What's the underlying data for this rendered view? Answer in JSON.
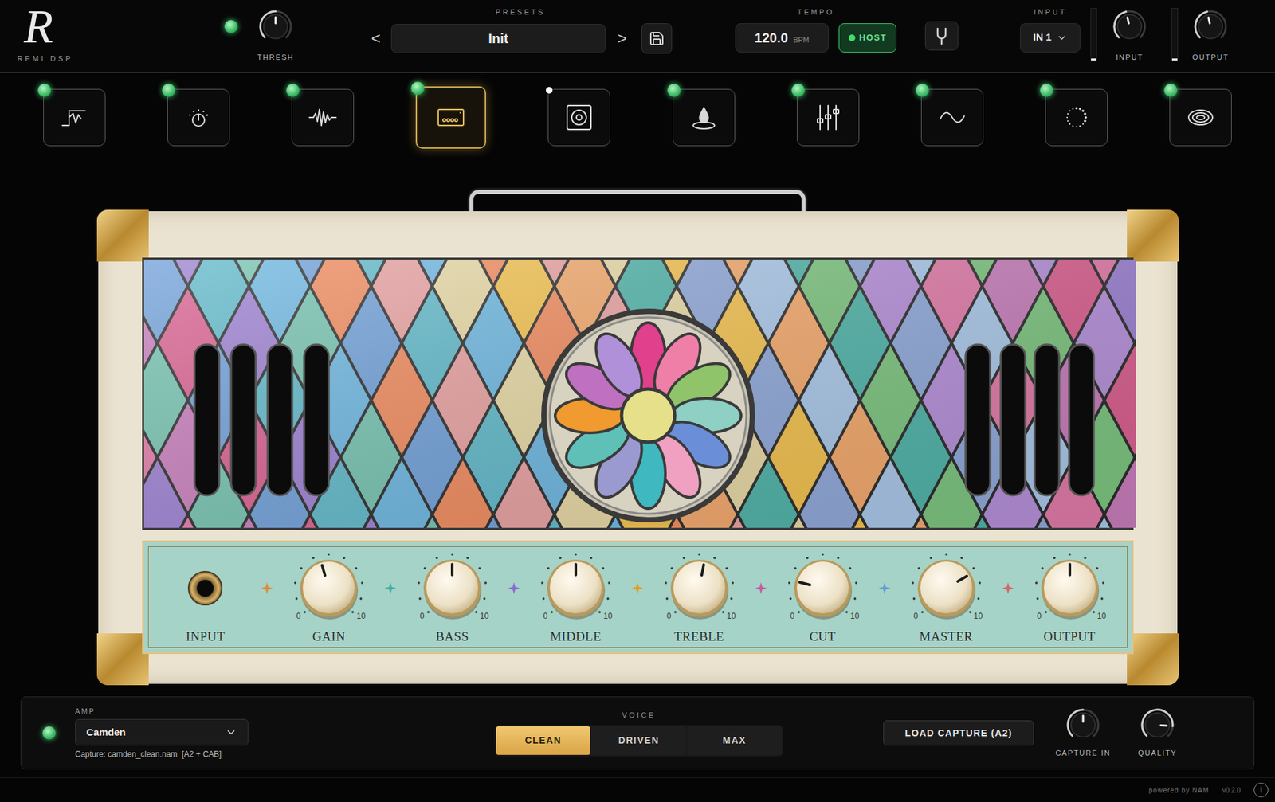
{
  "header": {
    "logo": {
      "mark": "R",
      "name": "REMI DSP"
    },
    "gate": {
      "on": true,
      "label": "THRESH",
      "level": 0.5
    },
    "presets": {
      "label": "PRESETS",
      "prev": "<",
      "name": "Init",
      "next": ">"
    },
    "tempo": {
      "label": "TEMPO",
      "value": "120.0",
      "unit": "BPM",
      "host": {
        "label": "HOST",
        "on": true
      }
    },
    "input": {
      "label": "INPUT",
      "source": "IN 1",
      "meters": [
        0.04,
        0.04
      ],
      "knobs": [
        {
          "label": "INPUT",
          "level": 0.45
        },
        {
          "label": "OUTPUT",
          "level": 0.45
        }
      ]
    }
  },
  "modules": [
    {
      "kind": "gate",
      "enabled": true,
      "selected": false
    },
    {
      "kind": "drive",
      "enabled": true,
      "selected": false
    },
    {
      "kind": "comp",
      "enabled": true,
      "selected": false
    },
    {
      "kind": "amp",
      "enabled": true,
      "selected": true
    },
    {
      "kind": "cab",
      "enabled": false,
      "selected": false
    },
    {
      "kind": "drop",
      "enabled": true,
      "selected": false
    },
    {
      "kind": "eq",
      "enabled": true,
      "selected": false
    },
    {
      "kind": "mod",
      "enabled": true,
      "selected": false
    },
    {
      "kind": "delay",
      "enabled": true,
      "selected": false
    },
    {
      "kind": "reverb",
      "enabled": true,
      "selected": false
    }
  ],
  "amp": {
    "controls": [
      {
        "kind": "jack",
        "label": "INPUT"
      },
      {
        "kind": "knob",
        "label": "GAIN",
        "level": 0.44,
        "min": "0",
        "max": "10"
      },
      {
        "kind": "knob",
        "label": "BASS",
        "level": 0.5,
        "min": "0",
        "max": "10"
      },
      {
        "kind": "knob",
        "label": "MIDDLE",
        "level": 0.5,
        "min": "0",
        "max": "10"
      },
      {
        "kind": "knob",
        "label": "TREBLE",
        "level": 0.54,
        "min": "0",
        "max": "10"
      },
      {
        "kind": "knob",
        "label": "CUT",
        "level": 0.22,
        "min": "0",
        "max": "10"
      },
      {
        "kind": "knob",
        "label": "MASTER",
        "level": 0.72,
        "min": "0",
        "max": "10"
      },
      {
        "kind": "knob",
        "label": "OUTPUT",
        "level": 0.5,
        "min": "0",
        "max": "10"
      }
    ]
  },
  "amp_panel": {
    "on": true,
    "label": "AMP",
    "model": "Camden",
    "capture": "Capture: camden_clean.nam  [A2 + CAB]",
    "voice": {
      "label": "VOICE",
      "options": [
        {
          "label": "CLEAN",
          "selected": true
        },
        {
          "label": "DRIVEN",
          "selected": false
        },
        {
          "label": "MAX",
          "selected": false
        }
      ]
    },
    "load_button": "LOAD CAPTURE (A2)",
    "knobs": [
      {
        "label": "CAPTURE IN",
        "level": 0.5
      },
      {
        "label": "QUALITY",
        "level": 0.85
      }
    ]
  },
  "footer": {
    "credit": "powered by NAM",
    "version": "v0.2.0",
    "info": "i"
  }
}
